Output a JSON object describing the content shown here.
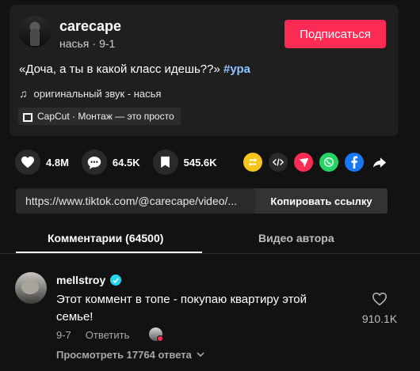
{
  "author": {
    "username": "carecape",
    "nickname": "насья",
    "date": "9-1",
    "follow_label": "Подписаться"
  },
  "description": {
    "text": "«Доча, а ты в какой класс идешь??»",
    "hashtag": "#ура"
  },
  "sound": {
    "label": "оригинальный звук - насья"
  },
  "capcut": {
    "label": "CapCut · Монтаж — это просто"
  },
  "stats": {
    "likes": "4.8M",
    "comments": "64.5K",
    "saves": "545.6K"
  },
  "share_icons": [
    "repost-icon",
    "embed-icon",
    "send-icon",
    "whatsapp-icon",
    "facebook-icon",
    "share-arrow-icon"
  ],
  "link": {
    "url": "https://www.tiktok.com/@carecape/video/...",
    "copy_label": "Копировать ссылку"
  },
  "tabs": {
    "comments": "Комментарии (64500)",
    "author_videos": "Видео автора"
  },
  "comment": {
    "username": "mellstroy",
    "text": "Этот коммент в топе - покупаю квартиру этой семье!",
    "date": "9-7",
    "reply_label": "Ответить",
    "likes": "910.1K",
    "view_replies": "Просмотреть 17764 ответа"
  },
  "colors": {
    "accent": "#fe2c55",
    "hashtag": "#8fc3ff",
    "background": "#121212",
    "card": "#1f1f1f"
  }
}
